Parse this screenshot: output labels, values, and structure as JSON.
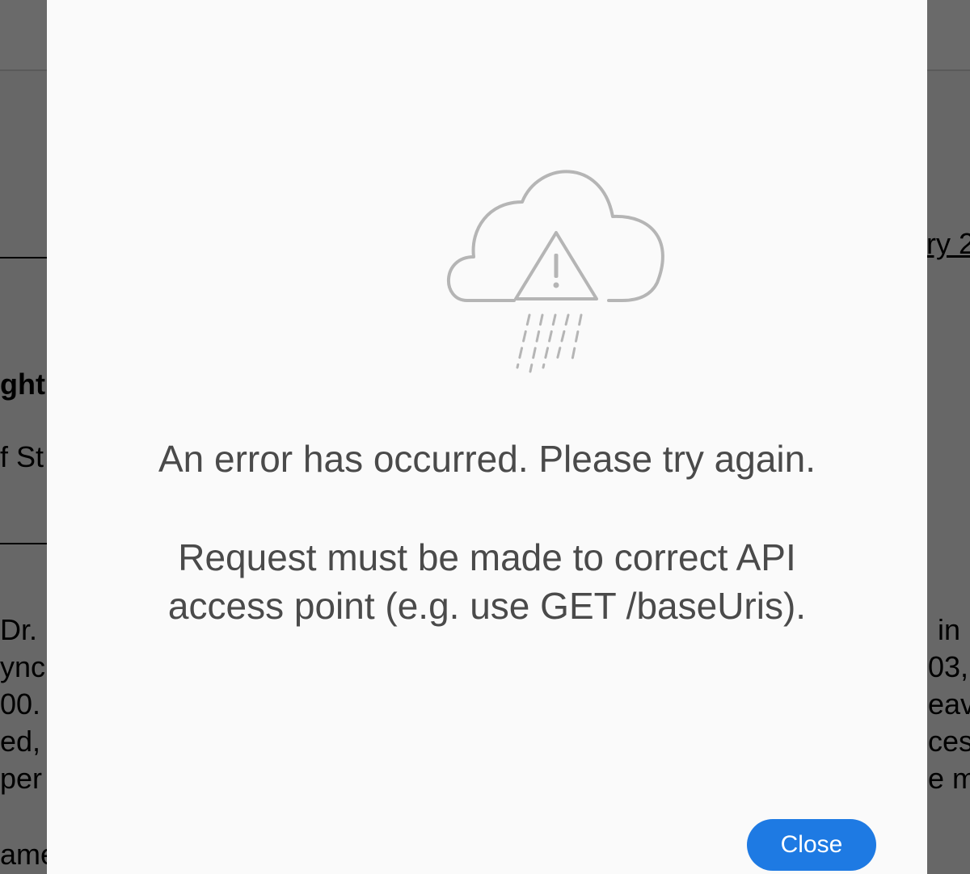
{
  "background": {
    "fragments": [
      {
        "text": "ry 2"
      },
      {
        "text": "ght"
      },
      {
        "text": "f St"
      },
      {
        "text": "Dr. I"
      },
      {
        "text": "ynch"
      },
      {
        "text": "00."
      },
      {
        "text": "ed, p"
      },
      {
        "text": "per"
      },
      {
        "text": "ame"
      },
      {
        "text": "in"
      },
      {
        "text": "03,"
      },
      {
        "text": "eav"
      },
      {
        "text": "ces"
      },
      {
        "text": "e m"
      }
    ]
  },
  "modal": {
    "icon": "cloud-rain-warning-icon",
    "title": "An error has occurred. Please try again.",
    "message_lines": [
      "Request must be made to correct API",
      "access point (e.g. use GET /baseUris)."
    ],
    "close_label": "Close",
    "accent_color": "#1e7ae3"
  }
}
